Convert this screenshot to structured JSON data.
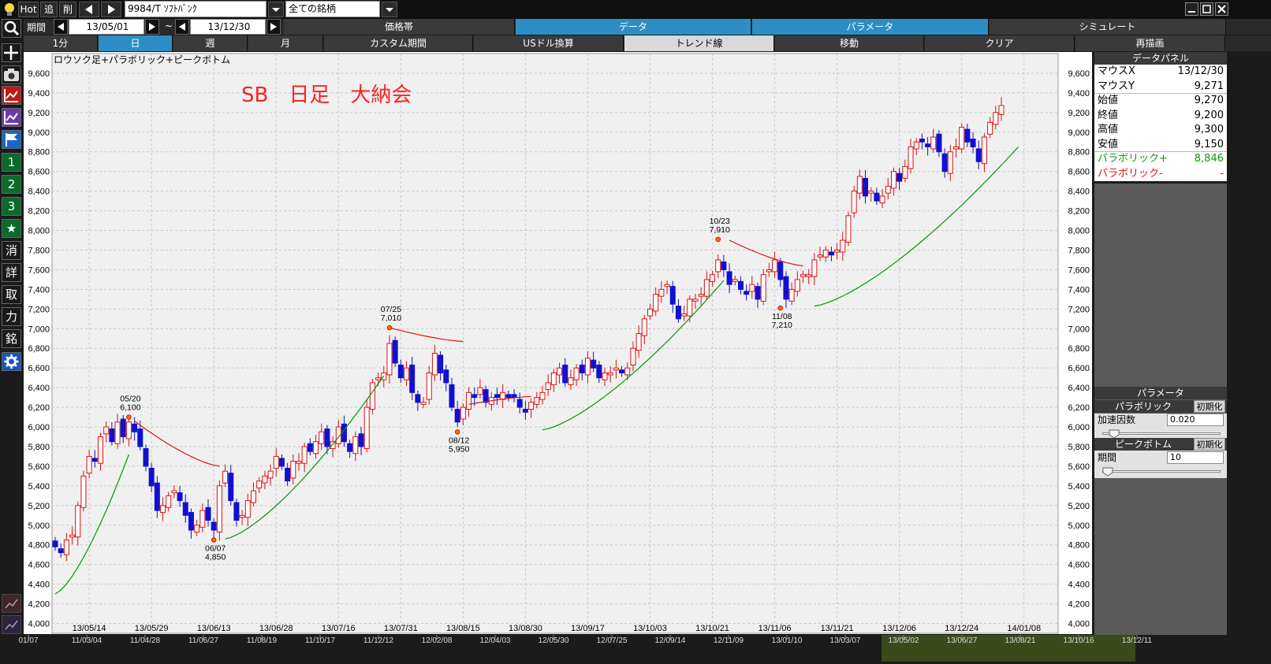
{
  "toolbar": {
    "hot_label": "Hot",
    "add_label": "追",
    "delete_label": "削",
    "symbol_value": "9984/T ｿﾌﾄﾊﾞﾝｸ",
    "group_value": "全ての銘柄"
  },
  "period": {
    "label": "期間",
    "start": "13/05/01",
    "separator": "~",
    "end": "13/12/30"
  },
  "top_tabs": [
    "価格帯",
    "データ",
    "パラメータ",
    "シミュレート"
  ],
  "timeframes": [
    "1分",
    "日",
    "週",
    "月",
    "カスタム期間"
  ],
  "timeframe_active": "日",
  "tools": [
    "USドル換算",
    "トレンド線",
    "移動",
    "クリア",
    "再描画"
  ],
  "left_icons": [
    "search-icon",
    "crosshair-icon",
    "camera-icon",
    "chart-red-icon",
    "chart-purple-icon",
    "flag-icon"
  ],
  "left_numbers": [
    "1",
    "2",
    "3"
  ],
  "left_kanji": [
    "消",
    "詳",
    "取",
    "力",
    "銘"
  ],
  "chart_label": "ロウソク足+パラボリック+ピークボトム",
  "chart_title": "SB　日足　大納会",
  "window_buttons": [
    "minimize-icon",
    "maximize-icon",
    "close-icon"
  ],
  "chart_data": {
    "type": "candlestick",
    "y_ticks": [
      "9,600",
      "9,400",
      "9,200",
      "9,000",
      "8,800",
      "8,600",
      "8,400",
      "8,200",
      "8,000",
      "7,800",
      "7,600",
      "7,400",
      "7,200",
      "7,000",
      "6,800",
      "6,600",
      "6,400",
      "6,200",
      "6,000",
      "5,800",
      "5,600",
      "5,400",
      "5,200",
      "5,000",
      "4,800",
      "4,600",
      "4,400",
      "4,200",
      "4,000"
    ],
    "ylim": [
      3900,
      9800
    ],
    "x_ticks": [
      "13/05/14",
      "13/05/29",
      "13/06/13",
      "13/06/28",
      "13/07/16",
      "13/07/31",
      "13/08/15",
      "13/08/30",
      "13/09/17",
      "13/10/03",
      "13/10/21",
      "13/11/06",
      "13/11/21",
      "13/12/06",
      "13/12/24",
      "14/01/08"
    ],
    "annotations": [
      {
        "date": "05/20",
        "value": "6,100",
        "price": 6100,
        "type": "peak",
        "idx": 13
      },
      {
        "date": "06/07",
        "value": "4,850",
        "price": 4850,
        "type": "bottom",
        "idx": 28
      },
      {
        "date": "07/25",
        "value": "7,010",
        "price": 7010,
        "type": "peak",
        "idx": 59
      },
      {
        "date": "08/12",
        "value": "5,950",
        "price": 5950,
        "type": "bottom",
        "idx": 71
      },
      {
        "date": "10/23",
        "value": "7,910",
        "price": 7910,
        "type": "peak",
        "idx": 117
      },
      {
        "date": "11/08",
        "value": "7,210",
        "price": 7210,
        "type": "bottom",
        "idx": 128
      }
    ],
    "closes": [
      4780,
      4720,
      4850,
      4900,
      5200,
      5500,
      5700,
      5650,
      5900,
      6000,
      5850,
      6050,
      5900,
      6050,
      5950,
      5800,
      5600,
      5400,
      5150,
      5200,
      5300,
      5350,
      5250,
      5100,
      4950,
      5000,
      5150,
      5050,
      4950,
      5400,
      5550,
      5250,
      5050,
      5100,
      5250,
      5350,
      5450,
      5500,
      5550,
      5700,
      5600,
      5450,
      5650,
      5650,
      5800,
      5750,
      5850,
      5950,
      5800,
      5850,
      6000,
      5850,
      5750,
      5900,
      5800,
      6200,
      6450,
      6500,
      6550,
      6850,
      6650,
      6500,
      6600,
      6350,
      6250,
      6250,
      6550,
      6750,
      6550,
      6450,
      6200,
      6050,
      6200,
      6350,
      6300,
      6400,
      6250,
      6300,
      6300,
      6350,
      6300,
      6300,
      6200,
      6150,
      6250,
      6300,
      6350,
      6450,
      6550,
      6600,
      6450,
      6500,
      6600,
      6550,
      6700,
      6600,
      6500,
      6550,
      6550,
      6600,
      6550,
      6600,
      6800,
      6950,
      7100,
      7200,
      7350,
      7400,
      7450,
      7250,
      7100,
      7150,
      7300,
      7300,
      7350,
      7500,
      7550,
      7700,
      7600,
      7450,
      7500,
      7400,
      7350,
      7450,
      7300,
      7550,
      7600,
      7700,
      7500,
      7300,
      7400,
      7500,
      7550,
      7550,
      7700,
      7750,
      7800,
      7750,
      7800,
      7900,
      8150,
      8400,
      8550,
      8350,
      8400,
      8300,
      8350,
      8450,
      8600,
      8500,
      8650,
      8850,
      8900,
      8900,
      8850,
      8950,
      8800,
      8600,
      8800,
      8850,
      9050,
      8900,
      8850,
      8700,
      8950,
      9100,
      9200,
      9271
    ],
    "psar": [
      {
        "x": [
          0,
          13
        ],
        "y": [
          4300,
          5720
        ],
        "c": "g"
      },
      {
        "x": [
          14,
          29
        ],
        "y": [
          6060,
          5600
        ],
        "c": "r"
      },
      {
        "x": [
          30,
          58
        ],
        "y": [
          4860,
          6520
        ],
        "c": "g"
      },
      {
        "x": [
          59,
          72
        ],
        "y": [
          7010,
          6870
        ],
        "c": "r"
      },
      {
        "x": [
          73,
          84
        ],
        "y": [
          6230,
          6310
        ],
        "c": "r"
      },
      {
        "x": [
          86,
          118
        ],
        "y": [
          5970,
          7490
        ],
        "c": "g"
      },
      {
        "x": [
          119,
          132
        ],
        "y": [
          7900,
          7640
        ],
        "c": "r"
      },
      {
        "x": [
          134,
          170
        ],
        "y": [
          7230,
          8850
        ],
        "c": "g"
      }
    ]
  },
  "data_panel": {
    "header": "データパネル",
    "rows": [
      {
        "label": "マウスX",
        "value": "13/12/30"
      },
      {
        "label": "マウスY",
        "value": "9,271"
      },
      {
        "label": "始値",
        "value": "9,270"
      },
      {
        "label": "終値",
        "value": "9,200"
      },
      {
        "label": "高値",
        "value": "9,300"
      },
      {
        "label": "安値",
        "value": "9,150"
      }
    ],
    "sar_plus_label": "パラボリック+",
    "sar_plus_value": "8,846",
    "sar_minus_label": "パラボリック-",
    "sar_minus_value": "-"
  },
  "params": {
    "header": "パラメータ",
    "parabolic": {
      "title": "パラボリック",
      "reset": "初期化",
      "field_label": "加速因数",
      "value": "0.020"
    },
    "peak": {
      "title": "ピークボトム",
      "reset": "初期化",
      "field_label": "期間",
      "value": "10"
    }
  },
  "colors": {
    "up": "#e01010",
    "down": "#1010d0",
    "psar_green": "#009900",
    "psar_red": "#e01010",
    "accent": "#2c8ec4",
    "title_red": "#ff2020"
  },
  "bottom_timeline": [
    "01/07",
    "11/03/04",
    "11/04/28",
    "11/06/27",
    "11/08/19",
    "11/10/17",
    "11/12/12",
    "12/02/08",
    "12/04/03",
    "12/05/30",
    "12/07/25",
    "12/09/14",
    "12/11/09",
    "13/01/10",
    "13/03/07",
    "13/05/02",
    "13/06/27",
    "13/08/21",
    "13/10/16",
    "13/12/11"
  ]
}
